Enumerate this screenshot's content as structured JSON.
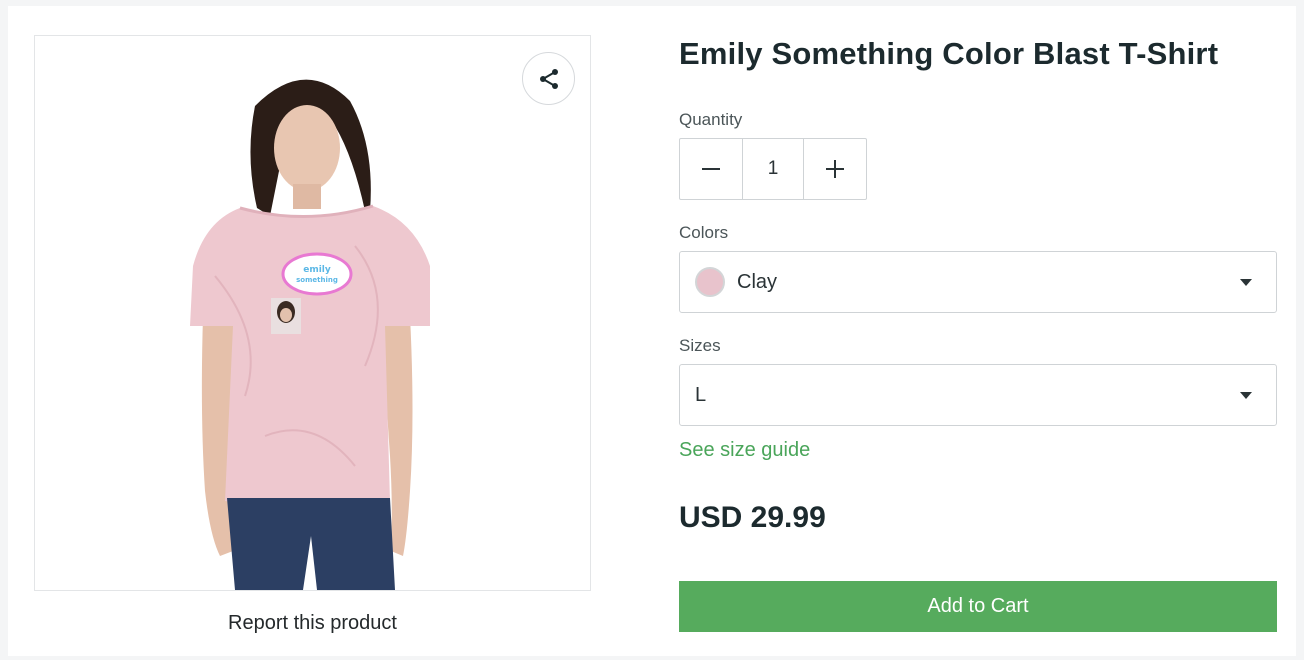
{
  "product": {
    "title": "Emily Something Color Blast T-Shirt",
    "image_alt": "Model wearing pink color blast t-shirt with emily something logo",
    "graphic_text": "emily something",
    "report_label": "Report this product"
  },
  "quantity": {
    "label": "Quantity",
    "value": "1",
    "decrement_symbol": "−",
    "increment_symbol": "+"
  },
  "colors": {
    "label": "Colors",
    "selected": "Clay",
    "swatch_color": "#e8c3cc"
  },
  "sizes": {
    "label": "Sizes",
    "selected": "L",
    "guide_link": "See size guide"
  },
  "price": "USD 29.99",
  "cart_button": "Add to Cart",
  "icons": {
    "share": "share-icon",
    "minus": "minus-icon",
    "plus": "plus-icon",
    "caret": "chevron-down-icon"
  },
  "theme": {
    "accent_green": "#56ab5d",
    "link_green": "#4aa55a",
    "title_color": "#1c2a2e"
  }
}
